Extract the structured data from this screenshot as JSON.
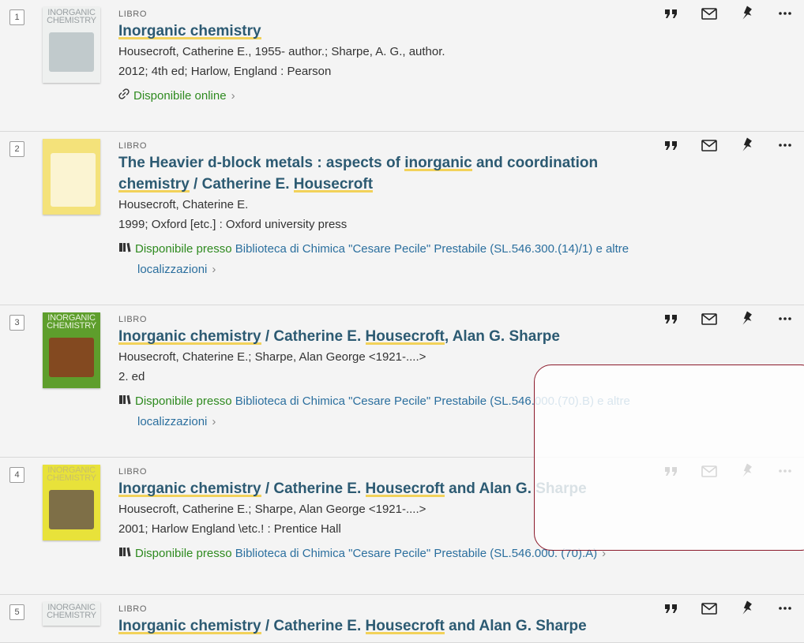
{
  "results": [
    {
      "num": "1",
      "type": "LIBRO",
      "title_parts": [
        {
          "text": "Inorganic chemistry",
          "hl": true
        }
      ],
      "meta": [
        "Housecroft, Catherine E., 1955- author.; Sharpe, A. G., author.",
        "2012; 4th ed; Harlow, England : Pearson"
      ],
      "availability": {
        "kind": "online",
        "label": "Disponibile online"
      },
      "cover": {
        "text": "INORGANIC\nCHEMISTRY",
        "bg": "#eef0ef",
        "art": "#b9c3c6",
        "text_color": "#9aa0a3"
      }
    },
    {
      "num": "2",
      "type": "LIBRO",
      "title_line1_parts": [
        {
          "text": "The Heavier d-block metals : aspects of ",
          "hl": false
        },
        {
          "text": "inorganic",
          "hl": true
        },
        {
          "text": " and coordination",
          "hl": false
        }
      ],
      "title_line2_parts": [
        {
          "text": "chemistry",
          "hl": true
        },
        {
          "text": " / Catherine E. ",
          "hl": false
        },
        {
          "text": "Housecroft",
          "hl": true
        }
      ],
      "meta": [
        "Housecroft, Chaterine E.",
        "1999; Oxford [etc.] : Oxford university press"
      ],
      "availability": {
        "kind": "library",
        "status": "Disponibile presso",
        "location": "Biblioteca di Chimica \"Cesare Pecile\"  Prestabile (SL.546.300.(14)/1) e altre",
        "more": "localizzazioni"
      },
      "cover": {
        "text": "",
        "bg": "#f4e27a",
        "art": "#fbf7e2",
        "text_color": "#555"
      }
    },
    {
      "num": "3",
      "type": "LIBRO",
      "title_parts": [
        {
          "text": "Inorganic chemistry",
          "hl": true
        },
        {
          "text": " / Catherine E. ",
          "hl": false
        },
        {
          "text": "Housecroft",
          "hl": true
        },
        {
          "text": ", Alan G. Sharpe",
          "hl": false
        }
      ],
      "meta": [
        "Housecroft, Chaterine E.; Sharpe, Alan George <1921-....>",
        "2. ed"
      ],
      "availability": {
        "kind": "library",
        "status": "Disponibile presso",
        "location": "Biblioteca di Chimica \"Cesare Pecile\"  Prestabile (SL.546.000.(70).B) e altre",
        "more": "localizzazioni"
      },
      "cover": {
        "text": "INORGANIC\nCHEMISTRY",
        "bg": "#5e9e2c",
        "art": "#8a3a1f",
        "text_color": "#e9f3df"
      }
    },
    {
      "num": "4",
      "type": "LIBRO",
      "title_parts": [
        {
          "text": "Inorganic chemistry",
          "hl": true
        },
        {
          "text": " / Catherine E. ",
          "hl": false
        },
        {
          "text": "Housecroft",
          "hl": true
        },
        {
          "text": " and Alan G. Sharpe",
          "hl": false
        }
      ],
      "meta": [
        "Housecroft, Catherine E.; Sharpe, Alan George <1921-....>",
        "2001; Harlow England \\etc.! : Prentice Hall"
      ],
      "availability": {
        "kind": "library-short",
        "status": "Disponibile presso",
        "location": "Biblioteca di Chimica \"Cesare Pecile\"  Prestabile (SL.546.000. (70).A)"
      },
      "cover": {
        "text": "INORGANIC\nCHEMISTRY",
        "bg": "#e8e23a",
        "art": "#6b5a4a",
        "text_color": "#c9c06a"
      }
    },
    {
      "num": "5",
      "type": "LIBRO",
      "title_parts": [
        {
          "text": "Inorganic chemistry",
          "hl": true
        },
        {
          "text": " / Catherine E. ",
          "hl": false
        },
        {
          "text": "Housecroft",
          "hl": true
        },
        {
          "text": " and Alan G. Sharpe",
          "hl": false
        }
      ],
      "meta": [],
      "availability": null,
      "cover": {
        "text": "INORGANIC\nCHEMISTRY",
        "bg": "#eef0ef",
        "art": "#b9c3c6",
        "text_color": "#9aa0a3"
      }
    }
  ],
  "actions": [
    {
      "name": "cite",
      "icon": "quote-icon"
    },
    {
      "name": "email",
      "icon": "envelope-icon"
    },
    {
      "name": "pin",
      "icon": "pin-icon"
    },
    {
      "name": "more",
      "icon": "more-dots-icon"
    }
  ],
  "colors": {
    "title": "#2c5a72",
    "highlight": "#f2d25a",
    "available_green": "#2e8a1f",
    "location_blue": "#2b6f9e",
    "overlay_border": "#8b1a2b"
  }
}
